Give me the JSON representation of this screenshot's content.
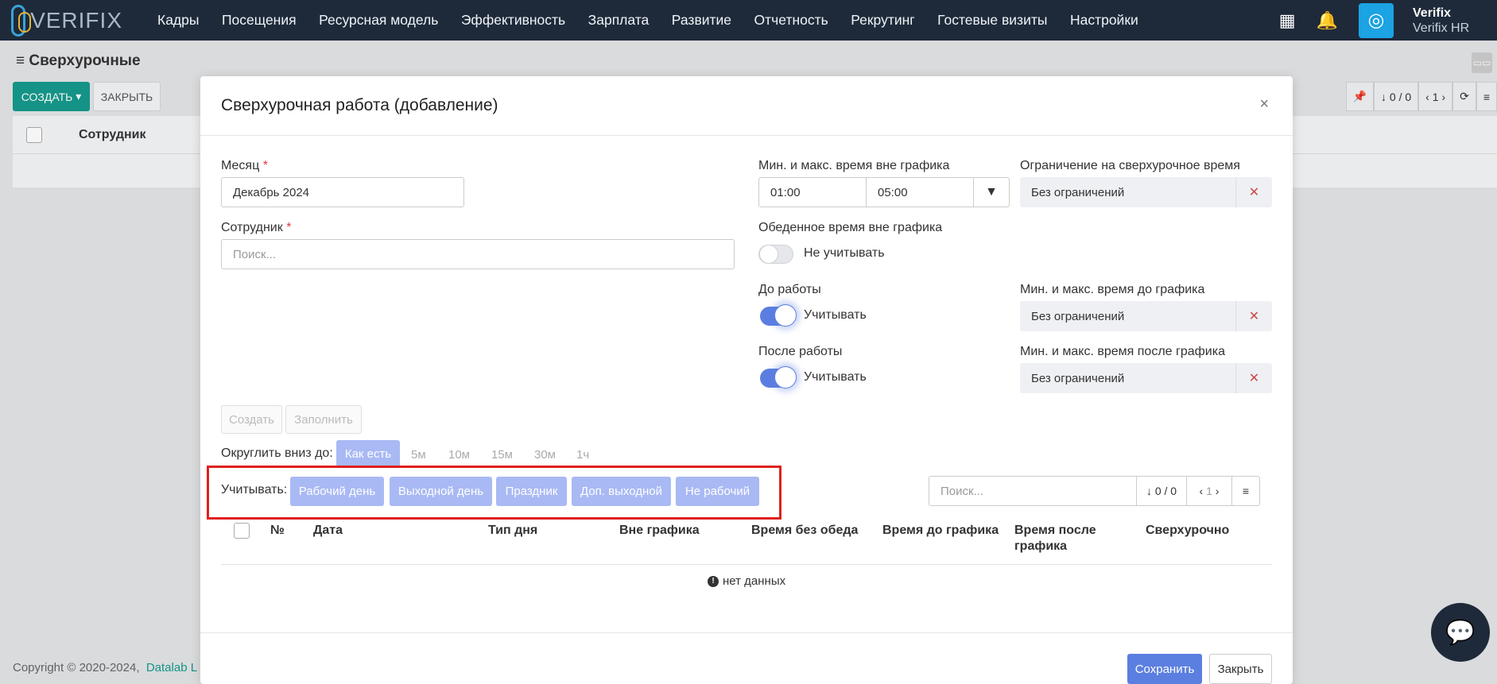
{
  "nav": {
    "logo_text": "VERIFIX",
    "menu": [
      "Кадры",
      "Посещения",
      "Ресурсная модель",
      "Эффективность",
      "Зарплата",
      "Развитие",
      "Отчетность",
      "Рекрутинг",
      "Гостевые визиты",
      "Настройки"
    ],
    "user_name": "Verifix",
    "company": "Verifix HR",
    "icons": [
      "grid-icon",
      "bell-icon",
      "fingerprint-icon"
    ]
  },
  "page": {
    "title": "Сверхурочные",
    "create_label": "СОЗДАТЬ",
    "close_label": "ЗАКРЫТЬ",
    "col_employee": "Сотрудник",
    "pager": "0 / 0",
    "page_num": "1"
  },
  "footer": {
    "copyright": "Copyright © 2020-2024,",
    "company_link": "Datalab L"
  },
  "modal": {
    "title": "Сверхурочная работа (добавление)",
    "close_x": "×",
    "month_label": "Месяц",
    "month_value": "Декабрь 2024",
    "employee_label": "Сотрудник",
    "employee_placeholder": "Поиск...",
    "minmax_label": "Мин. и макс. время вне графика",
    "min_time": "01:00",
    "max_time": "05:00",
    "limit_label": "Ограничение на сверхурочное время",
    "limit_value": "Без ограничений",
    "lunch_label": "Обеденное время вне графика",
    "lunch_toggle": "Не учитывать",
    "before_label": "До работы",
    "before_toggle": "Учитывать",
    "before_minmax_label": "Мин. и макс. время до графика",
    "before_minmax_value": "Без ограничений",
    "after_label": "После работы",
    "after_toggle": "Учитывать",
    "after_minmax_label": "Мин. и макс. время после графика",
    "after_minmax_value": "Без ограничений",
    "btn_create": "Создать",
    "btn_fill": "Заполнить",
    "round_label": "Округлить вниз до:",
    "round_options": [
      "Как есть",
      "5м",
      "10м",
      "15м",
      "30м",
      "1ч"
    ],
    "round_selected": "Как есть",
    "count_label": "Учитывать:",
    "count_chips": [
      "Рабочий день",
      "Выходной день",
      "Праздник",
      "Доп. выходной",
      "Не рабочий"
    ],
    "search_placeholder": "Поиск...",
    "pager": "0 / 0",
    "page_num": "1",
    "columns": [
      "№",
      "Дата",
      "Тип дня",
      "Вне графика",
      "Время без обеда",
      "Время до графика",
      "Время после графика",
      "Сверхурочно"
    ],
    "no_data": "нет данных",
    "save_label": "Сохранить",
    "close_label": "Закрыть"
  }
}
